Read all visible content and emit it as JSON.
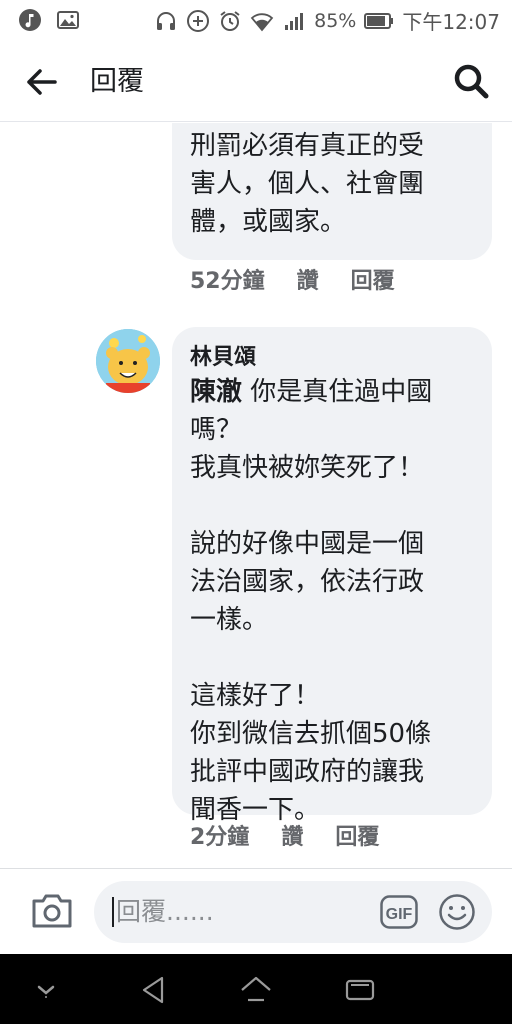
{
  "status_bar": {
    "battery_percent": "85%",
    "time": "下午12:07",
    "icons": [
      "music-app-icon",
      "gallery-icon",
      "headphones-icon",
      "add-circle-icon",
      "alarm-icon",
      "wifi-icon",
      "signal-icon",
      "battery-icon"
    ]
  },
  "header": {
    "title": "回覆",
    "back_icon": "arrow-left-icon",
    "search_icon": "search-icon"
  },
  "comments": [
    {
      "text": "上轉發才被抓，因為\n刑罰必須有真正的受\n害人，個人、社會團\n體，或國家。",
      "time": "52分鐘",
      "like_label": "讚",
      "reply_label": "回覆"
    },
    {
      "author": "林貝頌",
      "mention": "陳澈",
      "first_line_rest": " 你是真住過中國",
      "lines": [
        "嗎？",
        "我真快被妳笑死了！",
        "",
        "說的好像中國是一個",
        "法治國家，依法行政",
        "一樣。",
        "",
        "這樣好了！",
        "你到微信去抓個50條",
        "批評中國政府的讓我",
        "聞香一下。"
      ],
      "time": "2分鐘",
      "like_label": "讚",
      "reply_label": "回覆"
    }
  ],
  "composer": {
    "placeholder": "回覆......",
    "gif_label": "GIF"
  },
  "navbar": {
    "icons": [
      "chevron-down-icon",
      "back-triangle-icon",
      "home-icon",
      "recents-icon"
    ]
  }
}
